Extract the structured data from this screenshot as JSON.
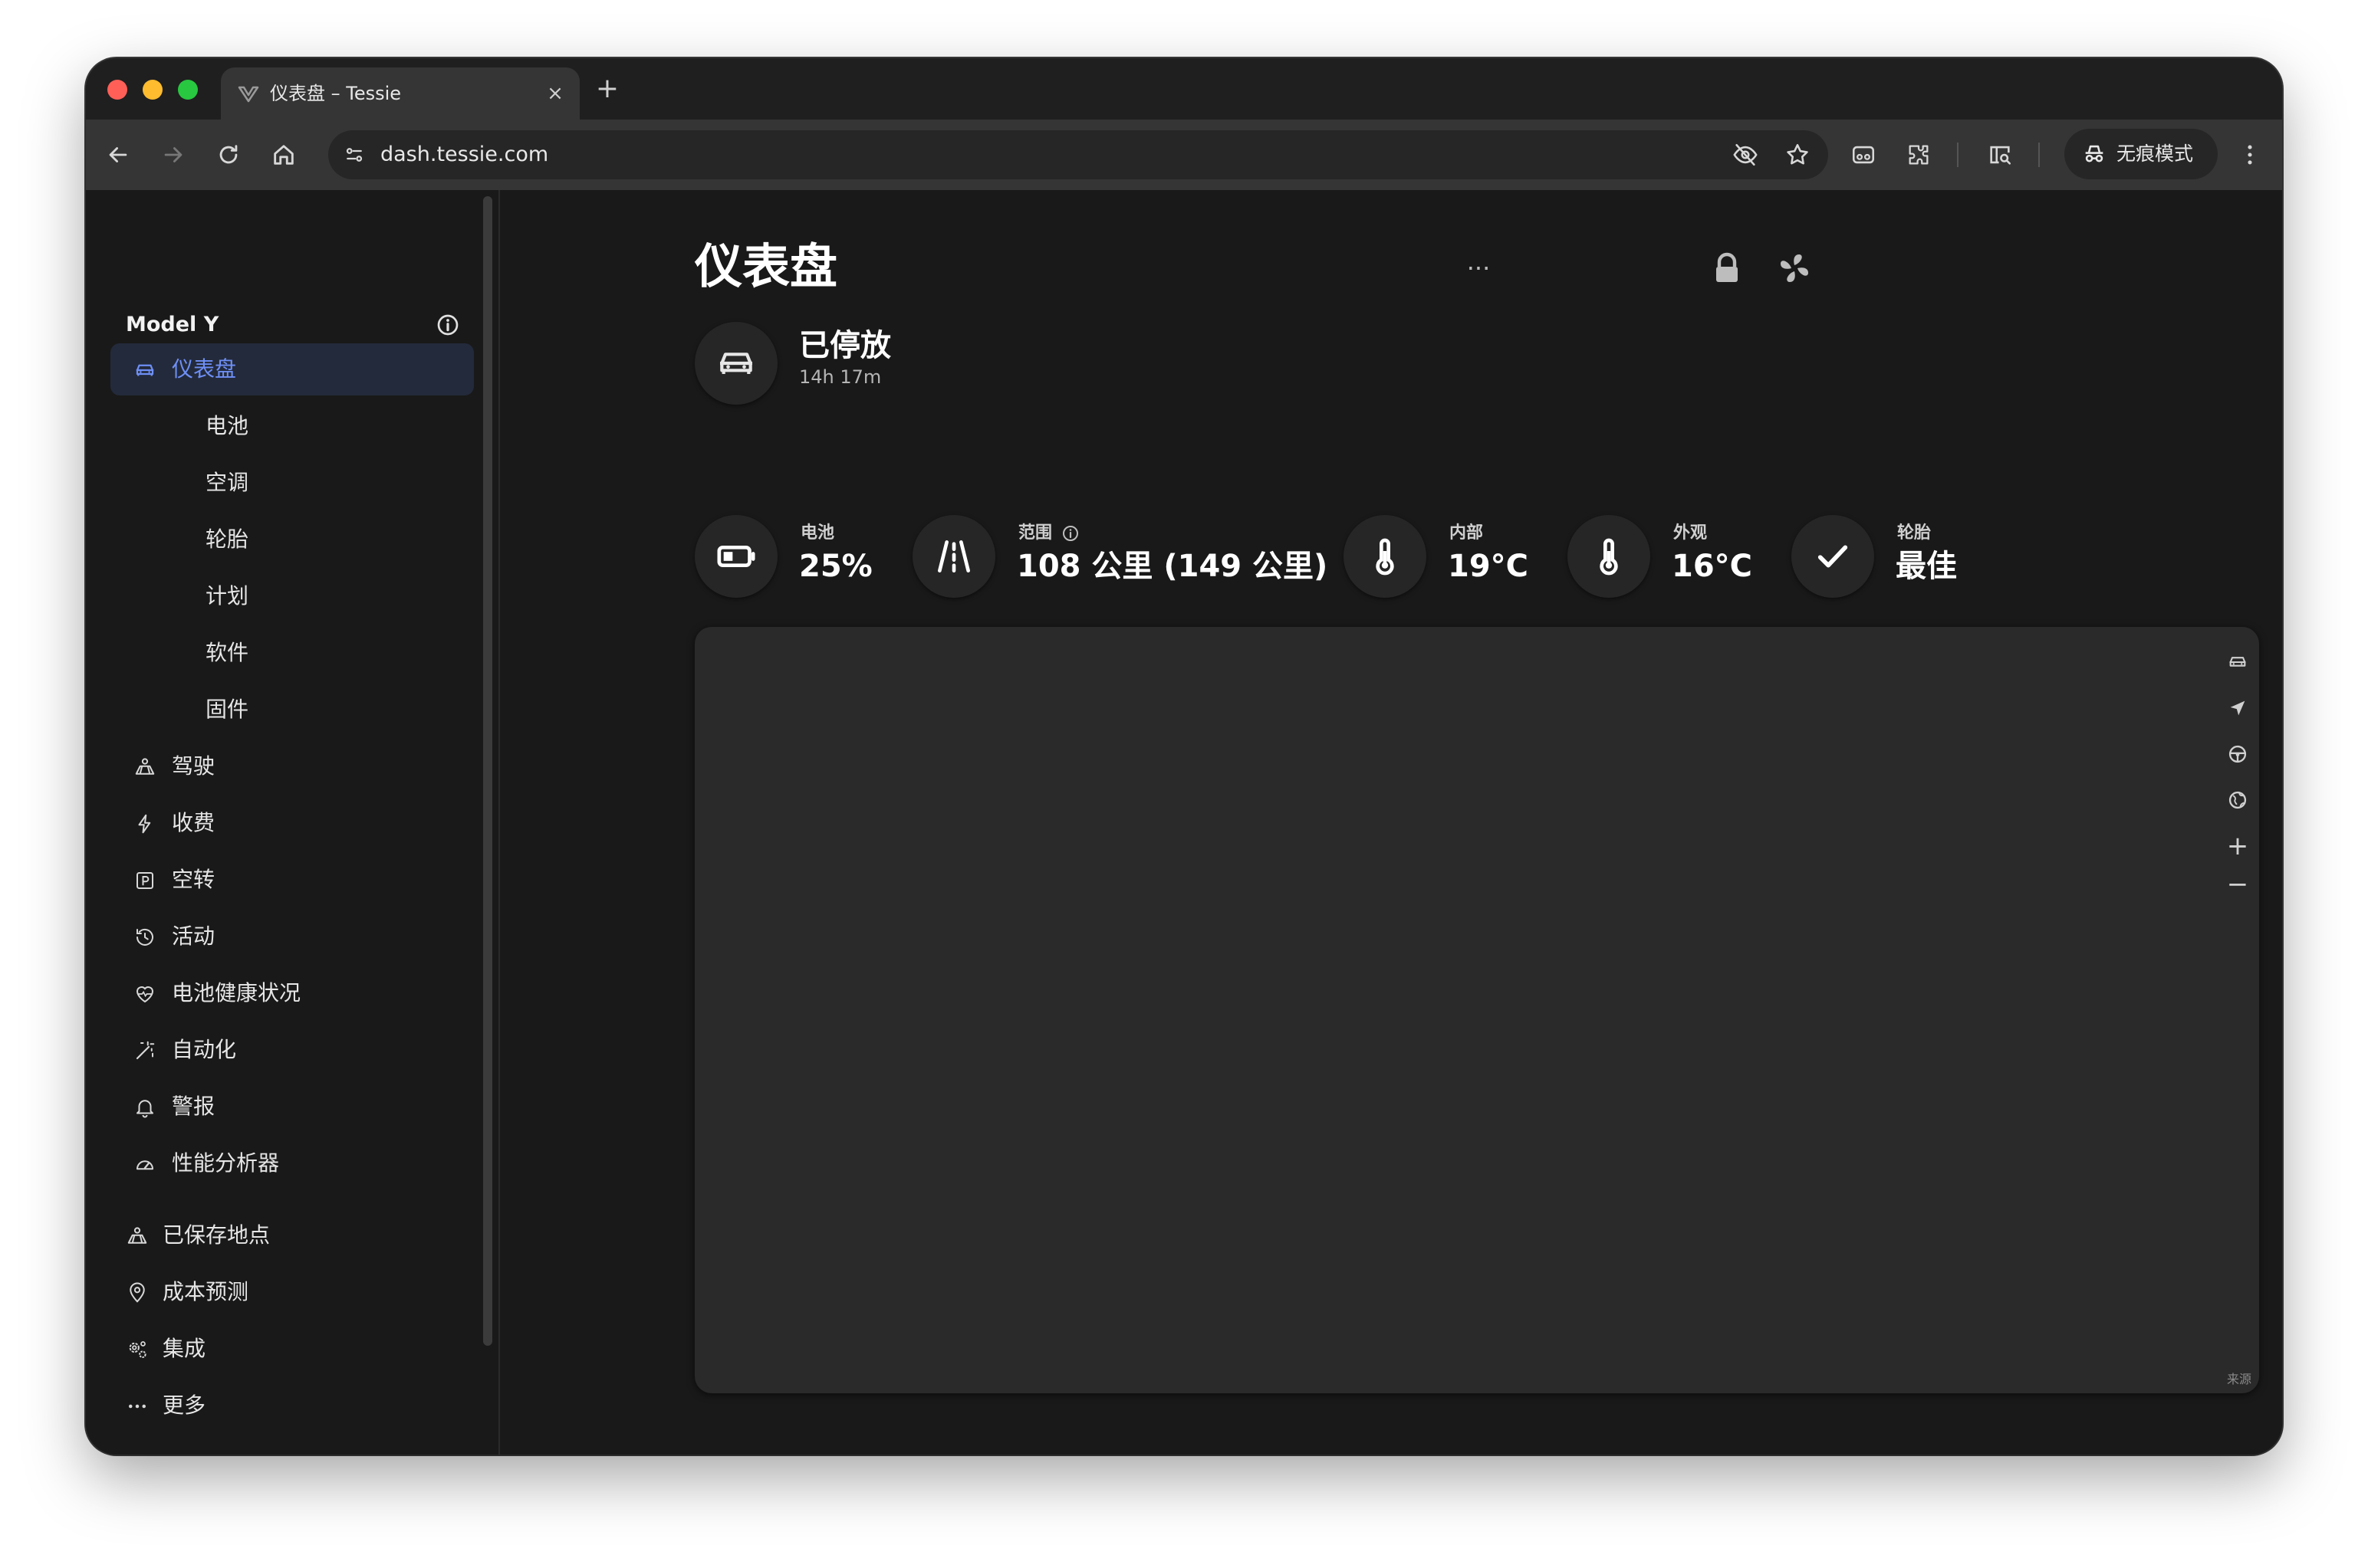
{
  "browser": {
    "tab_title": "仪表盘 – Tessie",
    "url": "dash.tessie.com",
    "incognito_label": "无痕模式",
    "tab_close": "×",
    "new_tab": "+"
  },
  "sidebar": {
    "vehicle_name": "Model Y",
    "items": [
      {
        "label": "仪表盘",
        "icon": "car-icon",
        "active": true
      },
      {
        "label": "电池"
      },
      {
        "label": "空调"
      },
      {
        "label": "轮胎"
      },
      {
        "label": "计划"
      },
      {
        "label": "软件"
      },
      {
        "label": "固件"
      },
      {
        "label": "驾驶",
        "icon": "map-route-icon"
      },
      {
        "label": "收费",
        "icon": "bolt-icon"
      },
      {
        "label": "空转",
        "icon": "parking-icon"
      },
      {
        "label": "活动",
        "icon": "history-icon"
      },
      {
        "label": "电池健康状况",
        "icon": "heart-pulse-icon"
      },
      {
        "label": "自动化",
        "icon": "magic-wand-icon"
      },
      {
        "label": "警报",
        "icon": "bell-icon"
      },
      {
        "label": "性能分析器",
        "icon": "gauge-icon"
      }
    ],
    "lower_items": [
      {
        "label": "已保存地点",
        "icon": "map-route-icon"
      },
      {
        "label": "成本预测",
        "icon": "location-pin-icon"
      },
      {
        "label": "集成",
        "icon": "gears-icon"
      },
      {
        "label": "更多",
        "icon": "ellipsis-icon"
      }
    ]
  },
  "main": {
    "title": "仪表盘",
    "more": "···",
    "status": {
      "title": "已停放",
      "duration": "14h 17m"
    },
    "stats": [
      {
        "label": "电池",
        "value": "25%",
        "icon": "battery-icon"
      },
      {
        "label": "范围",
        "value": "108 公里 (149 公里)",
        "icon": "road-icon"
      },
      {
        "label": "内部",
        "value": "19°C",
        "icon": "thermometer-icon"
      },
      {
        "label": "外观",
        "value": "16°C",
        "icon": "thermometer-icon"
      },
      {
        "label": "轮胎",
        "value": "最佳",
        "icon": "check-icon"
      }
    ],
    "map": {
      "zoom_in": "+",
      "zoom_out": "−",
      "attribution": "来源"
    }
  },
  "colors": {
    "accent": "#6e8ff5",
    "background": "#191919",
    "card": "#2a2a2a"
  }
}
